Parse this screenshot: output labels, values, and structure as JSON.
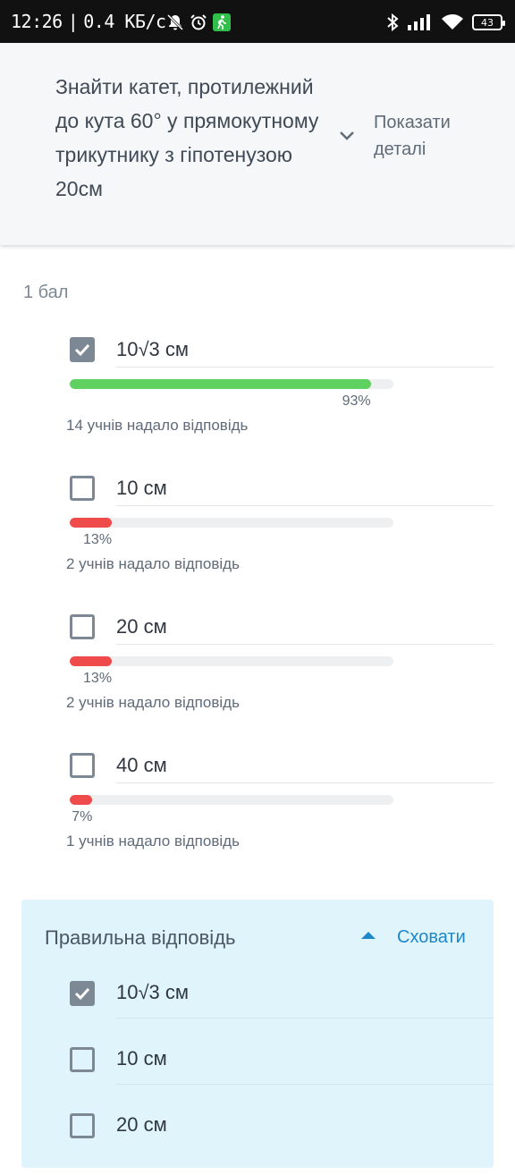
{
  "status_bar": {
    "time": "12:26",
    "separator": "|",
    "speed": "0.4 КБ/с",
    "battery": "43"
  },
  "question": {
    "text": "Знайти катет, протилежний до кута 60° у прямокутному трикутнику з гіпотенузою 20см",
    "details_label": "Показати деталі"
  },
  "points": "1 бал",
  "options": [
    {
      "label": "10√3 см",
      "checked": true,
      "percent": 93,
      "percent_text": "93%",
      "answered": "14 учнів надало відповідь",
      "color": "#5fd160"
    },
    {
      "label": "10 см",
      "checked": false,
      "percent": 13,
      "percent_text": "13%",
      "answered": "2 учнів надало відповідь",
      "color": "#ef4b4b"
    },
    {
      "label": "20 см",
      "checked": false,
      "percent": 13,
      "percent_text": "13%",
      "answered": "2 учнів надало відповідь",
      "color": "#ef4b4b"
    },
    {
      "label": "40 см",
      "checked": false,
      "percent": 7,
      "percent_text": "7%",
      "answered": "1 учнів надало відповідь",
      "color": "#ef4b4b"
    }
  ],
  "correct_answer": {
    "title": "Правильна відповідь",
    "hide_label": "Сховати",
    "options": [
      {
        "label": "10√3 см",
        "checked": true
      },
      {
        "label": "10 см",
        "checked": false
      },
      {
        "label": "20 см",
        "checked": false
      }
    ]
  }
}
